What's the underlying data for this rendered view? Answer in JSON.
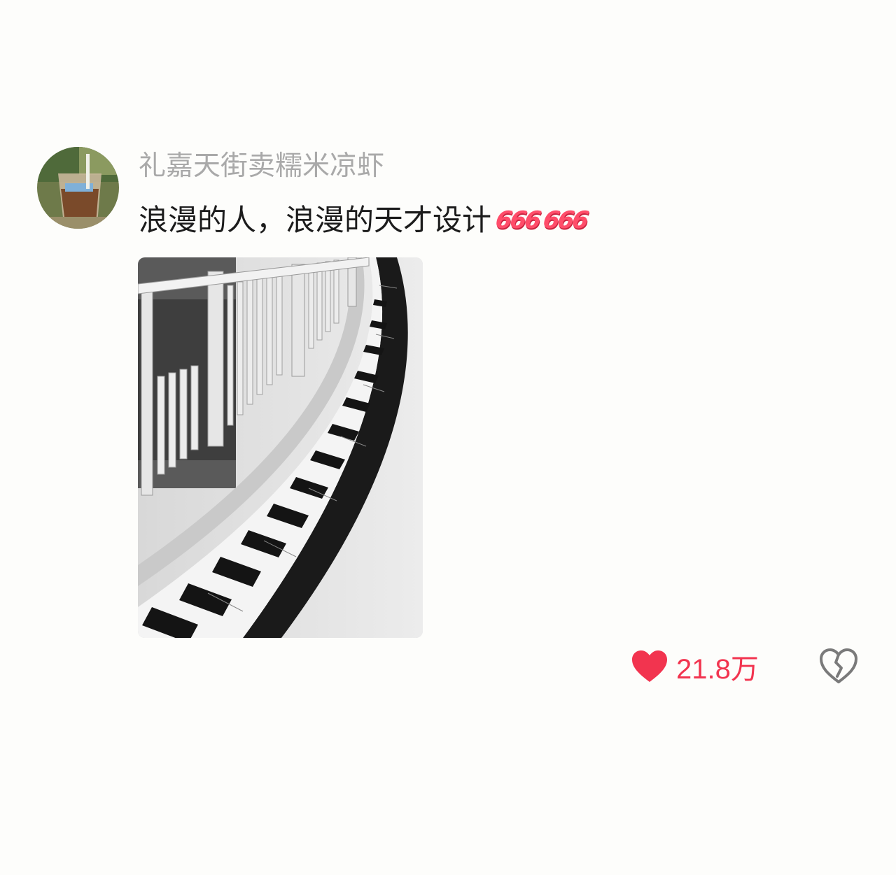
{
  "comment": {
    "username": "礼嘉天街卖糯米凉虾",
    "text": "浪漫的人，浪漫的天才设计",
    "emojis": [
      "666",
      "666"
    ],
    "avatar_icon": "iced-drink-photo",
    "photo_icon": "piano-keyboard-railing-photo",
    "likes": {
      "count": "21.8万",
      "icon": "heart-icon",
      "color": "#f2344f"
    },
    "dislike_icon": "broken-heart-icon"
  }
}
